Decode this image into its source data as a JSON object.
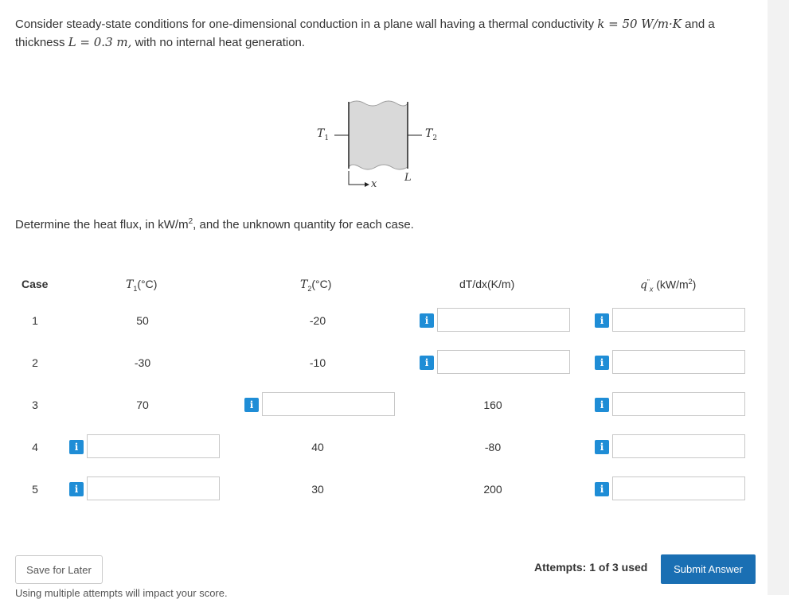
{
  "problem": {
    "text_line1": "Consider steady-state conditions for one-dimensional conduction in a plane wall having a thermal conductivity",
    "k_eq": "k = 50 W/m·K",
    "text_and": "and a",
    "text_line2a": "thickness",
    "L_eq": "L = 0.3 m,",
    "text_line2b": "with no internal heat generation."
  },
  "figure": {
    "t1": "T",
    "t1_sub": "1",
    "t2": "T",
    "t2_sub": "2",
    "x": "x",
    "L": "L"
  },
  "instruction": {
    "before": "Determine the heat flux, in kW/m",
    "sup": "2",
    "after": ", and the unknown quantity for each case."
  },
  "table": {
    "headers": {
      "case": "Case",
      "t1": "T",
      "t1_sub": "1",
      "t1_unit": "(°C)",
      "t2": "T",
      "t2_sub": "2",
      "t2_unit": "(°C)",
      "dtdx": "dT/dx(K/m)",
      "q": "q",
      "q_sup": "\"",
      "q_sub": "x",
      "q_unit": "(kW/m",
      "q_unit_sup": "2",
      "q_unit_end": ")"
    },
    "rows": [
      {
        "case": "1",
        "t1": "50",
        "t2": "-20",
        "dtdx": "",
        "q": ""
      },
      {
        "case": "2",
        "t1": "-30",
        "t2": "-10",
        "dtdx": "",
        "q": ""
      },
      {
        "case": "3",
        "t1": "70",
        "t2": "",
        "dtdx": "160",
        "q": ""
      },
      {
        "case": "4",
        "t1": "",
        "t2": "40",
        "dtdx": "-80",
        "q": ""
      },
      {
        "case": "5",
        "t1": "",
        "t2": "30",
        "dtdx": "200",
        "q": ""
      }
    ]
  },
  "info_icon_label": "i",
  "footer": {
    "save_label": "Save for Later",
    "attempts": "Attempts: 1 of 3 used",
    "submit_label": "Submit Answer",
    "note": "Using multiple attempts will impact your score."
  },
  "colors": {
    "info": "#1f8dd6",
    "submit": "#1a6fb3"
  }
}
